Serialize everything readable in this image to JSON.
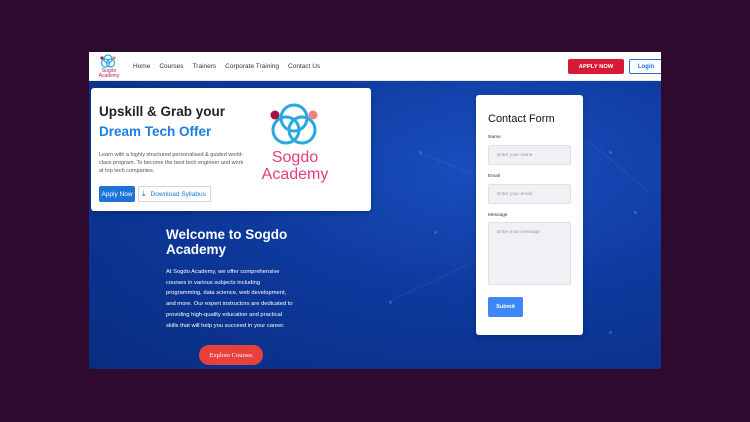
{
  "logo": {
    "name_line1": "Sogdo",
    "name_line2": "Academy"
  },
  "nav": {
    "items": [
      "Home",
      "Courses",
      "Trainers",
      "Corporate Training",
      "Contact Us"
    ],
    "apply_label": "APPLY NOW",
    "login_label": "Login"
  },
  "hero_card": {
    "heading_line1": "Upskill & Grab your",
    "heading_line2": "Dream Tech Offer",
    "description": "Learn with a highly structured personalised & guided world-class program. To become the best tech engineer and work at top tech companies.",
    "apply_label": "Apply Now",
    "download_label": "Download Syllabus",
    "brand_line1": "Sogdo",
    "brand_line2": "Academy"
  },
  "welcome": {
    "title": "Welcome to Sogdo Academy",
    "text": "At Sogdo Academy, we offer comprehensive courses in various subjects including programming, data science, web development, and more. Our expert instructors are dedicated to providing high-quality education and practical skills that will help you succeed in your career.",
    "explore_label": "Explore Courses"
  },
  "contact_form": {
    "title": "Contact Form",
    "name_label": "Name",
    "name_placeholder": "Enter your name",
    "email_label": "Email",
    "email_placeholder": "Enter your email",
    "message_label": "Message",
    "message_placeholder": "Enter your message",
    "submit_label": "Submit"
  },
  "colors": {
    "page_background": "#2e0a2f",
    "hero_blue": "#0e3a9e",
    "accent_red": "#d81b34",
    "accent_blue": "#1e73d8",
    "brand_pink": "#e53d7a"
  },
  "icons": [
    "logo-knot-icon",
    "download-icon"
  ]
}
